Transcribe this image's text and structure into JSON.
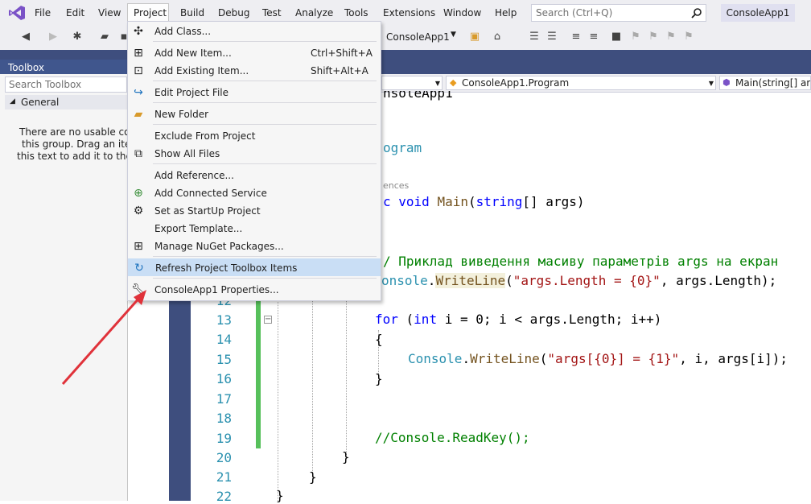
{
  "colors": {
    "accent": "#3e4e7e",
    "menu_bg": "#eeeef2",
    "highlight": "#c9def5",
    "arrow": "#e0323a",
    "green_bar": "#57c05b"
  },
  "menubar": {
    "logo_icon": "visual-studio-logo-icon",
    "items": [
      "File",
      "Edit",
      "View",
      "Project",
      "Build",
      "Debug",
      "Test",
      "Analyze",
      "Tools",
      "Extensions",
      "Window",
      "Help"
    ],
    "search_placeholder": "Search (Ctrl+Q)",
    "search_icon": "search-icon",
    "app_title": "ConsoleApp1"
  },
  "toolbar": {
    "project_dropdown": "ConsoleApp1"
  },
  "toolbox": {
    "title": "Toolbox",
    "search_placeholder": "Search Toolbox",
    "group": "General",
    "empty_lines": [
      "There are no usable contr",
      "this group. Drag an item",
      "this text to add it to the to"
    ]
  },
  "navbar": {
    "class_box": "ConsoleApp1.Program",
    "member_box": "Main(string[] args"
  },
  "editor": {
    "line_numbers": [
      "12",
      "13",
      "14",
      "15",
      "16",
      "17",
      "18",
      "19",
      "20",
      "21",
      "22"
    ],
    "top_fragments": {
      "namespace_tail": "nsoleApp1",
      "class_tail": "ogram",
      "references": "ences",
      "main_sig": "c void Main(string[] args)"
    },
    "comment_line": "/ Приклад виведення масиву параметрів args на екран",
    "writeline1": "onsole.WriteLine(\"args.Length = {0}\", args.Length);",
    "for_line": "for (int i = 0; i < args.Length; i++)",
    "open_brace": "{",
    "writeline2": "Console.WriteLine(\"args[{0}] = {1}\", i, args[i]);",
    "close_brace": "}",
    "readkey": "//Console.ReadKey();",
    "brace20": "}",
    "brace21": "}",
    "brace22": "}"
  },
  "project_menu": {
    "items": [
      {
        "label": "Add Class...",
        "shortcut": "",
        "icon": "add-class-icon"
      },
      {
        "label": "Add New Item...",
        "shortcut": "Ctrl+Shift+A",
        "icon": "add-new-item-icon"
      },
      {
        "label": "Add Existing Item...",
        "shortcut": "Shift+Alt+A",
        "icon": "add-existing-item-icon"
      },
      {
        "label": "Edit Project File",
        "shortcut": "",
        "icon": "edit-project-file-icon"
      },
      {
        "label": "New Folder",
        "shortcut": "",
        "icon": "new-folder-icon"
      },
      {
        "label": "Exclude From Project",
        "shortcut": "",
        "icon": ""
      },
      {
        "label": "Show All Files",
        "shortcut": "",
        "icon": "show-all-files-icon"
      },
      {
        "label": "Add Reference...",
        "shortcut": "",
        "icon": ""
      },
      {
        "label": "Add Connected Service",
        "shortcut": "",
        "icon": "connected-service-icon"
      },
      {
        "label": "Set as StartUp Project",
        "shortcut": "",
        "icon": "gear-icon"
      },
      {
        "label": "Export Template...",
        "shortcut": "",
        "icon": ""
      },
      {
        "label": "Manage NuGet Packages...",
        "shortcut": "",
        "icon": "nuget-icon"
      },
      {
        "label": "Refresh Project Toolbox Items",
        "shortcut": "",
        "icon": "refresh-icon"
      },
      {
        "label": "ConsoleApp1 Properties...",
        "shortcut": "",
        "icon": "wrench-icon"
      }
    ]
  }
}
